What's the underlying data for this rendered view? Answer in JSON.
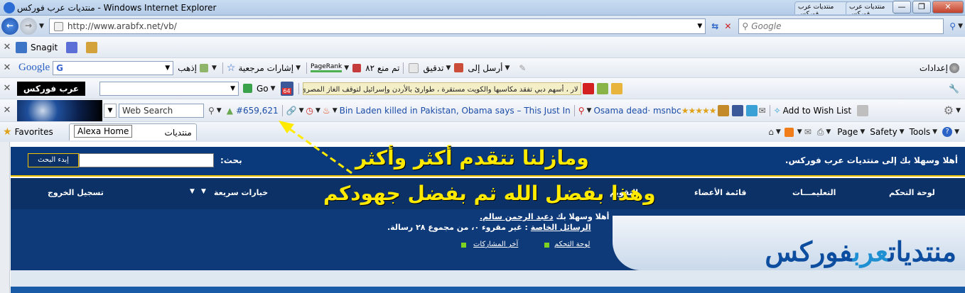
{
  "window": {
    "title": "منتديات عرب فوركس - Windows Internet Explorer",
    "tab1": "منتديات عرب فوركس",
    "tab2": "منتديات عرب فوركس"
  },
  "address": {
    "url": "http://www.arabfx.net/vb/",
    "search_placeholder": "Google"
  },
  "snagit": {
    "label": "Snagit"
  },
  "googlebar": {
    "brand": "Google",
    "search_value": "G",
    "go": "إذهب",
    "bookmarks": "إشارات مرجعية",
    "pagerank": "PageRank",
    "blocked": "تم منع ٨٢",
    "check": "تدقيق",
    "send": "أرسل إلى",
    "settings": "إعدادات"
  },
  "arabfxbar": {
    "brand": "عرب فوركس",
    "go": "Go",
    "badge": "64",
    "ticker": "لار ، أسهم دبي تفقد مكاسبها والكويت مستقرة ، طوارئ بالأردن وإسرائيل لتوقف الغاز المصري ، اليابان تسجل أ"
  },
  "alexabar": {
    "search_value": "Web Search",
    "rank": "#659,621",
    "news1": "Bin Laden killed in Pakistan, Obama says – This Just In",
    "news2": "Osama dead· msnbc",
    "wishlist": "Add to Wish List"
  },
  "favbar": {
    "favorites": "Favorites",
    "tab_title": "منتديات",
    "tooltip": "Alexa Home",
    "page": "Page",
    "safety": "Safety",
    "tools": "Tools"
  },
  "forum": {
    "welcome": "أهلا وسهلا بك إلى منتديات عرب فوركس.",
    "search_label": "بحث:",
    "search_button": "إبدء البحث",
    "nav": {
      "control": "لوحة التحكم",
      "faq": "التعليمـــات",
      "members": "قائمة الأعضاء",
      "calendar": "التقويم",
      "quick": "خيارات سريعة",
      "logout": "تسجيل الخروج"
    },
    "user": {
      "greeting": "أهلا وسهلا بك",
      "username": "دعبد الرحمن سالم.",
      "pm_link": "الرسائل الخاصة",
      "pm_text": ": غير مقروء ٠، من مجموع ٢٨ رسالة.",
      "cp": "لوحة التحكم",
      "latest": "آخر المشاركات"
    },
    "logo": {
      "part1": "منتديات",
      "part2": "عرب",
      "part3": "فوركس"
    }
  },
  "overlay": {
    "line1": "ومازلنا نتقدم أكثر وأكثر",
    "line2": "وهذا بفضل الله ثم بفضل جهودكم"
  }
}
